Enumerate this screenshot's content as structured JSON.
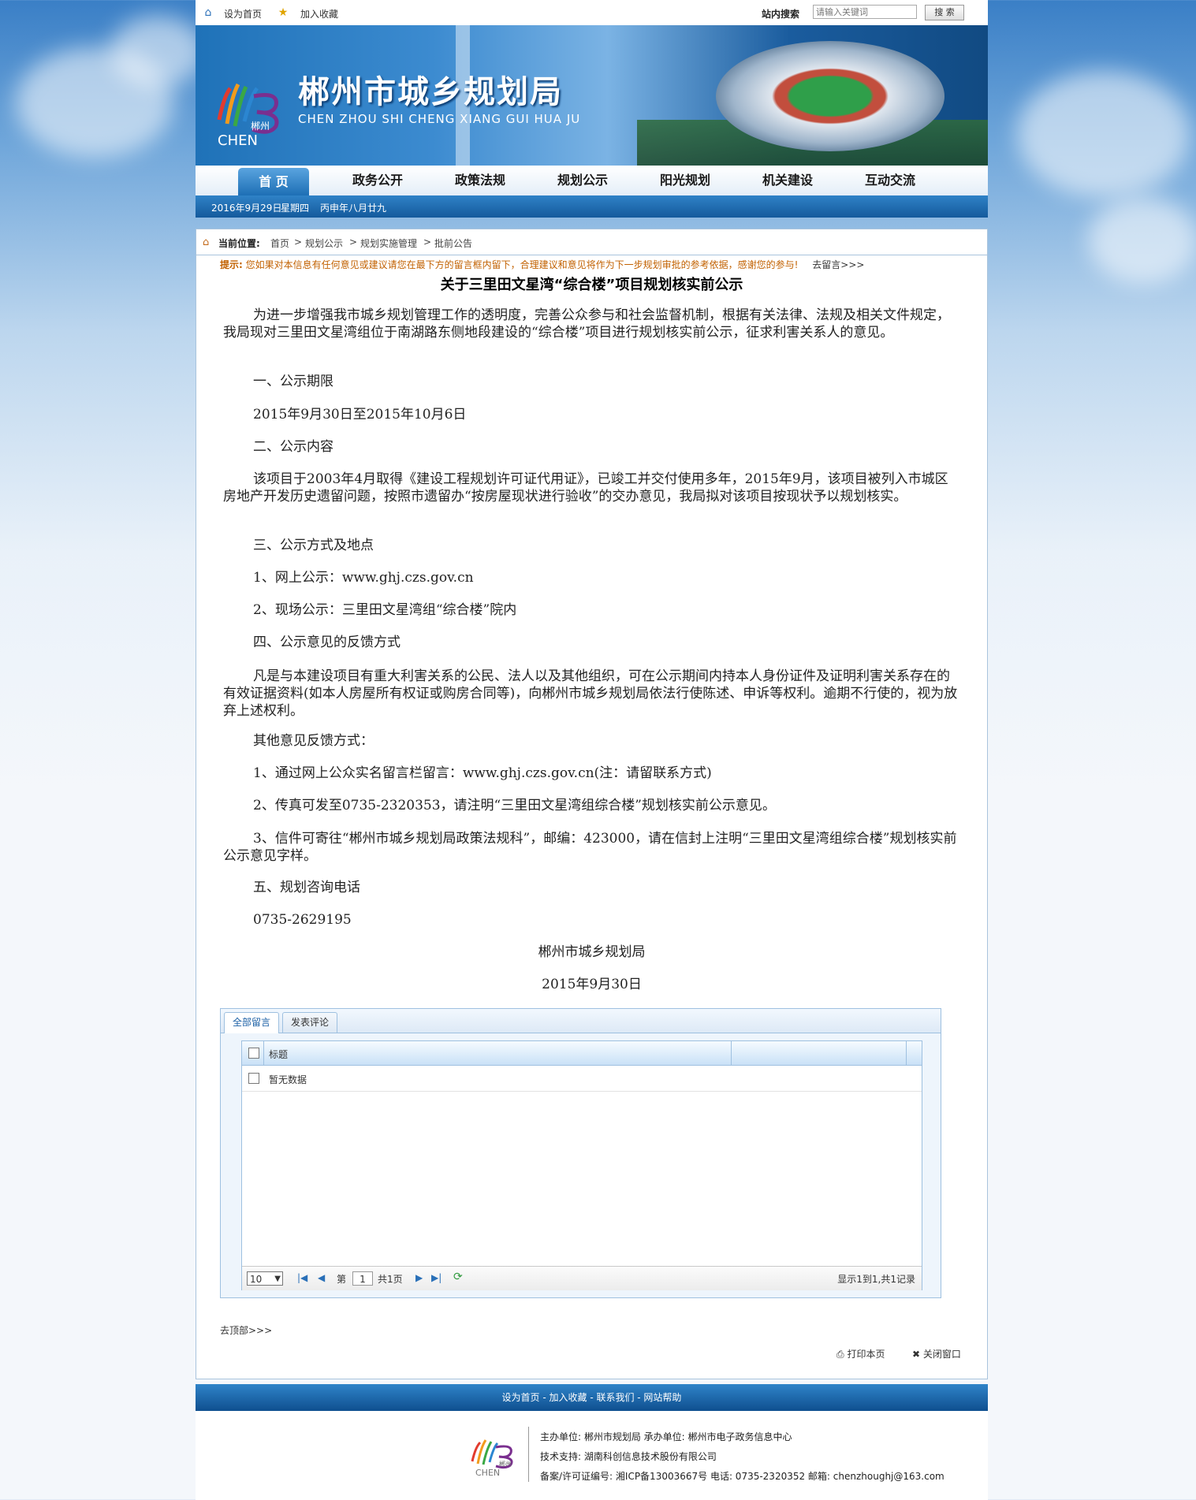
{
  "topbar": {
    "set_home": "设为首页",
    "add_fav": "加入收藏",
    "search_label": "站内搜索",
    "search_placeholder": "请输入关键词",
    "search_button": "搜 索"
  },
  "banner": {
    "title_cn": "郴州市城乡规划局",
    "title_en": "CHEN ZHOU SHI CHENG XIANG GUI HUA JU",
    "logo_text": "郴州",
    "logo_sub": "CHEN"
  },
  "nav": {
    "items": [
      "首 页",
      "政务公开",
      "政策法规",
      "规划公示",
      "阳光规划",
      "机关建设",
      "互动交流"
    ],
    "active": 0
  },
  "datebar": {
    "date": "2016年9月29日",
    "weekday": "星期四",
    "lunar": "丙申年八月廿九"
  },
  "breadcrumb": {
    "label": "当前位置:",
    "items": [
      "首页",
      "规划公示",
      "规划实施管理",
      "批前公告"
    ]
  },
  "notice": {
    "prefix": "提示:",
    "text": "您如果对本信息有任何意见或建议请您在最下方的留言框内留下，合理建议和意见将作为下一步规划审批的参考依据，感谢您的参与!",
    "link": "去留言>>>"
  },
  "article": {
    "title": "关于三里田文星湾“综合楼”项目规划核实前公示",
    "paragraphs": [
      "为进一步增强我市城乡规划管理工作的透明度，完善公众参与和社会监督机制，根据有关法律、法规及相关文件规定，我局现对三里田文星湾组位于南湖路东侧地段建设的“综合楼”项目进行规划核实前公示，征求利害关系人的意见。",
      "一、公示期限",
      "2015年9月30日至2015年10月6日",
      "二、公示内容",
      "该项目于2003年4月取得《建设工程规划许可证代用证》，已竣工并交付使用多年，2015年9月，该项目被列入市城区房地产开发历史遗留问题，按照市遗留办“按房屋现状进行验收”的交办意见，我局拟对该项目按现状予以规划核实。",
      "三、公示方式及地点",
      "1、网上公示：www.ghj.czs.gov.cn",
      "2、现场公示：三里田文星湾组“综合楼”院内",
      "四、公示意见的反馈方式",
      "凡是与本建设项目有重大利害关系的公民、法人以及其他组织，可在公示期间内持本人身份证件及证明利害关系存在的有效证据资料(如本人房屋所有权证或购房合同等)，向郴州市城乡规划局依法行使陈述、申诉等权利。逾期不行使的，视为放弃上述权利。",
      "其他意见反馈方式：",
      "1、通过网上公众实名留言栏留言：www.ghj.czs.gov.cn(注：请留联系方式)",
      "2、传真可发至0735-2320353，请注明“三里田文星湾组综合楼”规划核实前公示意见。",
      "3、信件可寄往“郴州市城乡规划局政策法规科”，邮编：423000，请在信封上注明“三里田文星湾组综合楼”规划核实前公示意见字样。",
      "五、规划咨询电话",
      "0735-2629195"
    ],
    "signature": "郴州市城乡规划局",
    "sign_date": "2015年9月30日"
  },
  "comments": {
    "tabs": [
      "全部留言",
      "发表评论"
    ],
    "column_title": "标题",
    "empty_text": "暂无数据",
    "page_size": "10",
    "page_prefix": "第",
    "page_value": "1",
    "page_total": "共1页",
    "record_info": "显示1到1,共1记录"
  },
  "page_actions": {
    "to_top": "去顶部>>>",
    "print": "打印本页",
    "close": "关闭窗口"
  },
  "footer": {
    "links": "设为首页 - 加入收藏 - 联系我们 - 网站帮助",
    "line1": "主办单位: 郴州市规划局  承办单位: 郴州市电子政务信息中心",
    "line2": "技术支持: 湖南科创信息技术股份有限公司",
    "line3": "备案/许可证编号: 湘ICP备13003667号  电话: 0735-2320352  邮箱: chenzhoughj@163.com"
  }
}
